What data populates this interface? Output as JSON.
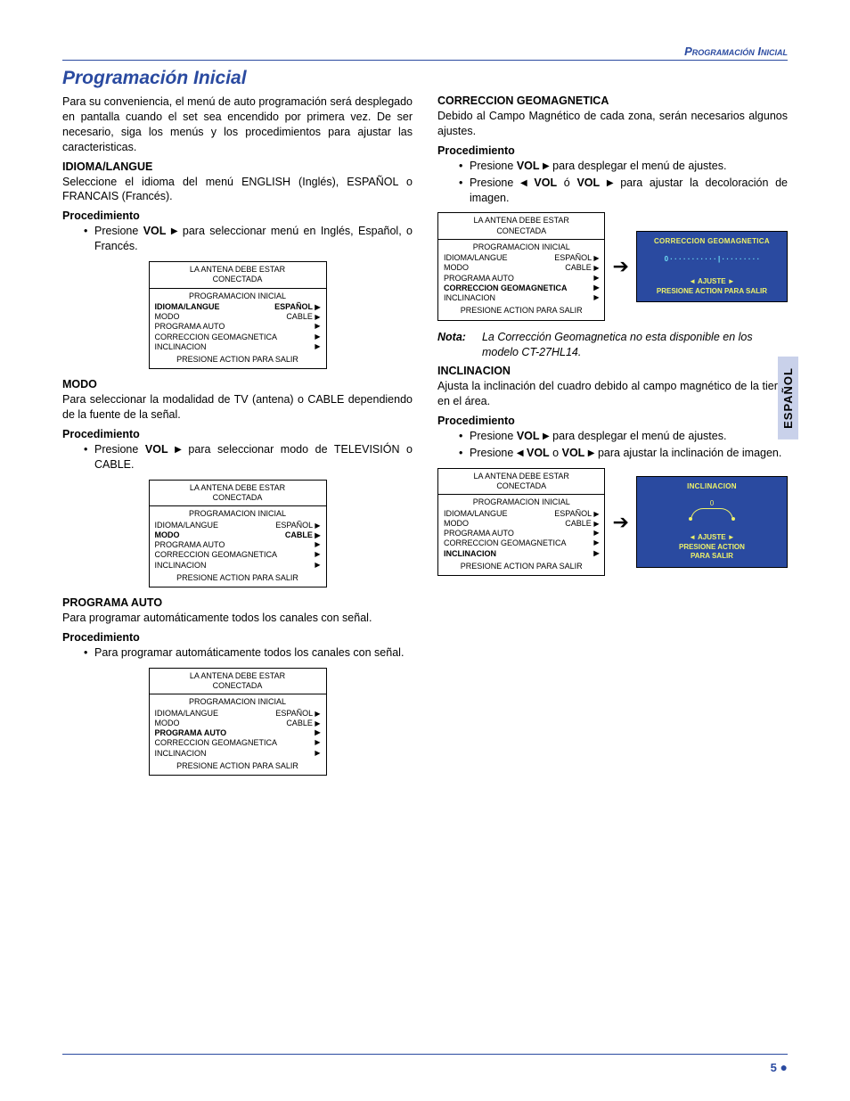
{
  "header": {
    "runningTitle": "Programación Inicial"
  },
  "title": "Programación Inicial",
  "sideTab": "ESPAÑOL",
  "footer": {
    "pageNum": "5"
  },
  "intro": "Para su conveniencia, el menú de auto programación será desplegado en pantalla cuando el set sea encendido por primera vez. De ser necesario, siga los menús y los procedimientos para ajustar las caracteristicas.",
  "idioma": {
    "heading": "IDIOMA/LANGUE",
    "text": "Seleccione el idioma del menú ENGLISH (Inglés), ESPAÑOL o FRANCAIS (Francés).",
    "procLabel": "Procedimiento",
    "bullet_pre": "Presione ",
    "bullet_vol": "VOL",
    "bullet_post": " para seleccionar menú en Inglés, Español, o Francés."
  },
  "modo": {
    "heading": "MODO",
    "text": "Para seleccionar la modalidad de TV (antena) o CABLE dependiendo de la fuente de la señal.",
    "procLabel": "Procedimiento",
    "bullet_pre": "Presione ",
    "bullet_vol": "VOL",
    "bullet_post": " para seleccionar modo de TELEVISIÓN o CABLE."
  },
  "programa": {
    "heading": "PROGRAMA AUTO",
    "text": "Para programar automáticamente todos los canales con señal.",
    "procLabel": "Procedimiento",
    "bullet": "Para programar automáticamente todos los canales con señal."
  },
  "correccion": {
    "heading": "CORRECCION GEOMAGNETICA",
    "text": "Debido al Campo Magnético de cada zona, serán necesarios algunos ajustes.",
    "procLabel": "Procedimiento",
    "b1_pre": "Presione ",
    "b1_vol": "VOL",
    "b1_post": " para desplegar el menú de ajustes.",
    "b2_pre": "Presione ",
    "b2_vol1": "VOL",
    "b2_mid": " ó ",
    "b2_vol2": "VOL",
    "b2_post": " para ajustar la decoloración de imagen."
  },
  "note": {
    "label": "Nota:",
    "text": "La Corrección Geomagnetica no esta disponible en los modelo CT-27HL14."
  },
  "inclinacion": {
    "heading": "INCLINACION",
    "text": "Ajusta la inclinación del cuadro debido al campo magnético de la tierra en el área.",
    "procLabel": "Procedimiento",
    "b1_pre": "Presione ",
    "b1_vol": "VOL",
    "b1_post": " para desplegar  el menú de ajustes.",
    "b2_pre": "Presione ",
    "b2_vol1": "VOL",
    "b2_mid": " o ",
    "b2_vol2": "VOL",
    "b2_post": " para ajustar la inclinación de imagen."
  },
  "menu": {
    "top1": "LA  ANTENA DEBE ESTAR",
    "top2": "CONECTADA",
    "title": "PROGRAMACION INICIAL",
    "rows": {
      "idioma": "IDIOMA/LANGUE",
      "idioma_val": "ESPAÑOL",
      "modo": "MODO",
      "modo_val": "CABLE",
      "programa": "PROGRAMA  AUTO",
      "correccion": "CORRECCION GEOMAGNETICA",
      "inclinacion": "INCLINACION"
    },
    "foot": "PRESIONE ACTION PARA SALIR"
  },
  "bluePanel1": {
    "title": "CORRECCION GEOMAGNETICA",
    "mid": "0 · · · · · · · · · · · | · · · · · · · · ·",
    "adjust": "◄     AJUSTE     ►",
    "exit": "PRESIONE ACTION PARA SALIR"
  },
  "bluePanel2": {
    "title": "INCLINACION",
    "zero": "0",
    "adjust": "◄     AJUSTE     ►",
    "exit1": "PRESIONE  ACTION",
    "exit2": "PARA  SALIR"
  }
}
